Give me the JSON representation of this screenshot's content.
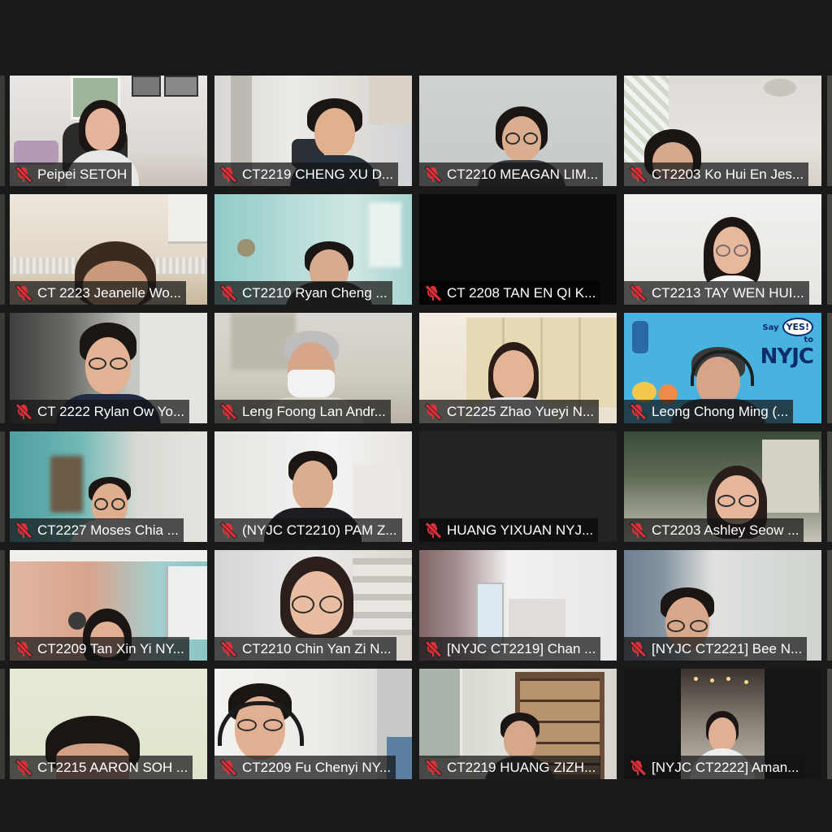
{
  "meeting": {
    "participants": [
      {
        "name": "Peipei SETOH",
        "muted": true
      },
      {
        "name": "CT2219 CHENG XU D...",
        "muted": true
      },
      {
        "name": "CT2210 MEAGAN LIM...",
        "muted": true
      },
      {
        "name": "CT2203 Ko Hui En Jes...",
        "muted": true
      },
      {
        "name": "CT 2223 Jeanelle Wo...",
        "muted": true
      },
      {
        "name": "CT2210 Ryan Cheng ...",
        "muted": true
      },
      {
        "name": "CT 2208 TAN EN QI K...",
        "muted": true
      },
      {
        "name": "CT2213 TAY WEN HUI...",
        "muted": true
      },
      {
        "name": "CT 2222 Rylan Ow Yo...",
        "muted": true
      },
      {
        "name": "Leng Foong Lan Andr...",
        "muted": true
      },
      {
        "name": "CT2225 Zhao Yueyi N...",
        "muted": true
      },
      {
        "name": "Leong Chong Ming (...",
        "muted": true
      },
      {
        "name": "CT2227 Moses Chia ...",
        "muted": true
      },
      {
        "name": "(NYJC CT2210) PAM Z...",
        "muted": true
      },
      {
        "name": "HUANG YIXUAN NYJ...",
        "muted": true
      },
      {
        "name": "CT2203 Ashley Seow ...",
        "muted": true
      },
      {
        "name": "CT2209 Tan Xin Yi NY...",
        "muted": true
      },
      {
        "name": "CT2210 Chin Yan Zi N...",
        "muted": true
      },
      {
        "name": "[NYJC CT2219] Chan ...",
        "muted": true
      },
      {
        "name": "[NYJC CT2221] Bee N...",
        "muted": true
      },
      {
        "name": "CT2215 AARON SOH ...",
        "muted": true
      },
      {
        "name": "CT2209 Fu Chenyi NY...",
        "muted": true
      },
      {
        "name": "CT2219 HUANG ZIZH...",
        "muted": true
      },
      {
        "name": "[NYJC CT2222] Aman...",
        "muted": true
      }
    ],
    "virtual_background_text": {
      "say": "Say",
      "yes": "YES!",
      "to": "to",
      "brand": "NYJC"
    }
  },
  "colors": {
    "app_background": "#1a1a1a",
    "muted_icon": "#e0313b",
    "label_text": "#ffffff"
  },
  "icons": {
    "muted": "microphone-muted-icon"
  }
}
